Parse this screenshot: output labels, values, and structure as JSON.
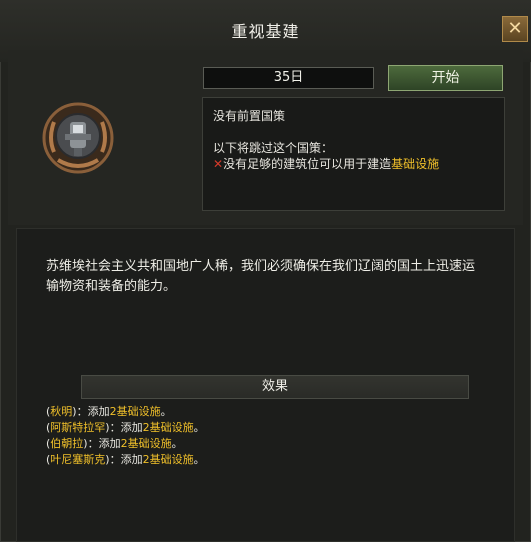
{
  "window": {
    "title": "重视基建",
    "close_label": "✕"
  },
  "focus": {
    "duration": "35日",
    "start_label": "开始",
    "no_prereq": "没有前置国策",
    "skip_header": "以下将跳过这个国策：",
    "skip_reason_prefix": "没有足够的建筑位可以用于建造",
    "skip_reason_building": "基础设施",
    "description": "苏维埃社会主义共和国地广人稀，我们必须确保在我们辽阔的国土上迅速运输物资和装备的能力。"
  },
  "effects": {
    "header": "效果",
    "rows": [
      {
        "state": "秋明",
        "middle": "：添加",
        "amount": "2",
        "building": "基础设施",
        "end": "。"
      },
      {
        "state": "阿斯特拉罕",
        "middle": "：添加",
        "amount": "2",
        "building": "基础设施",
        "end": "。"
      },
      {
        "state": "伯朝拉",
        "middle": "：添加",
        "amount": "2",
        "building": "基础设施",
        "end": "。"
      },
      {
        "state": "叶尼塞斯克",
        "middle": "：添加",
        "amount": "2",
        "building": "基础设施",
        "end": "。"
      }
    ]
  },
  "colors": {
    "highlight": "#f0c02a",
    "cross": "#d33a2a",
    "start_button": "#3e5a31"
  },
  "icons": {
    "emblem": "focus-emblem-icon",
    "close": "close-icon",
    "cross": "cross-icon"
  }
}
